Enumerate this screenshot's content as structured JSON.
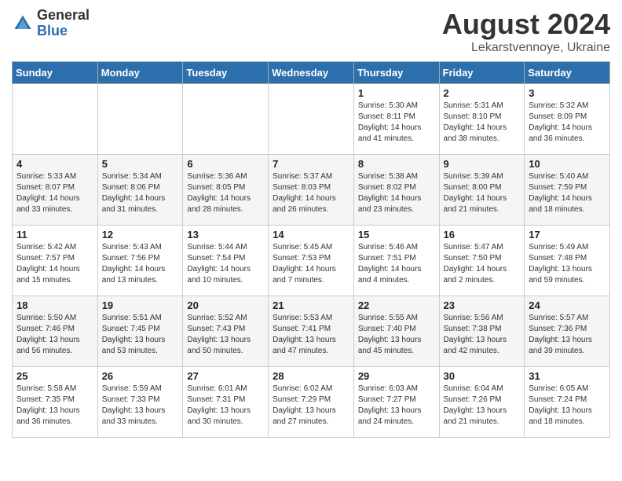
{
  "logo": {
    "general": "General",
    "blue": "Blue"
  },
  "title": "August 2024",
  "location": "Lekarstvennоye, Ukraine",
  "days_of_week": [
    "Sunday",
    "Monday",
    "Tuesday",
    "Wednesday",
    "Thursday",
    "Friday",
    "Saturday"
  ],
  "weeks": [
    [
      {
        "day": "",
        "info": ""
      },
      {
        "day": "",
        "info": ""
      },
      {
        "day": "",
        "info": ""
      },
      {
        "day": "",
        "info": ""
      },
      {
        "day": "1",
        "info": "Sunrise: 5:30 AM\nSunset: 8:11 PM\nDaylight: 14 hours\nand 41 minutes."
      },
      {
        "day": "2",
        "info": "Sunrise: 5:31 AM\nSunset: 8:10 PM\nDaylight: 14 hours\nand 38 minutes."
      },
      {
        "day": "3",
        "info": "Sunrise: 5:32 AM\nSunset: 8:09 PM\nDaylight: 14 hours\nand 36 minutes."
      }
    ],
    [
      {
        "day": "4",
        "info": "Sunrise: 5:33 AM\nSunset: 8:07 PM\nDaylight: 14 hours\nand 33 minutes."
      },
      {
        "day": "5",
        "info": "Sunrise: 5:34 AM\nSunset: 8:06 PM\nDaylight: 14 hours\nand 31 minutes."
      },
      {
        "day": "6",
        "info": "Sunrise: 5:36 AM\nSunset: 8:05 PM\nDaylight: 14 hours\nand 28 minutes."
      },
      {
        "day": "7",
        "info": "Sunrise: 5:37 AM\nSunset: 8:03 PM\nDaylight: 14 hours\nand 26 minutes."
      },
      {
        "day": "8",
        "info": "Sunrise: 5:38 AM\nSunset: 8:02 PM\nDaylight: 14 hours\nand 23 minutes."
      },
      {
        "day": "9",
        "info": "Sunrise: 5:39 AM\nSunset: 8:00 PM\nDaylight: 14 hours\nand 21 minutes."
      },
      {
        "day": "10",
        "info": "Sunrise: 5:40 AM\nSunset: 7:59 PM\nDaylight: 14 hours\nand 18 minutes."
      }
    ],
    [
      {
        "day": "11",
        "info": "Sunrise: 5:42 AM\nSunset: 7:57 PM\nDaylight: 14 hours\nand 15 minutes."
      },
      {
        "day": "12",
        "info": "Sunrise: 5:43 AM\nSunset: 7:56 PM\nDaylight: 14 hours\nand 13 minutes."
      },
      {
        "day": "13",
        "info": "Sunrise: 5:44 AM\nSunset: 7:54 PM\nDaylight: 14 hours\nand 10 minutes."
      },
      {
        "day": "14",
        "info": "Sunrise: 5:45 AM\nSunset: 7:53 PM\nDaylight: 14 hours\nand 7 minutes."
      },
      {
        "day": "15",
        "info": "Sunrise: 5:46 AM\nSunset: 7:51 PM\nDaylight: 14 hours\nand 4 minutes."
      },
      {
        "day": "16",
        "info": "Sunrise: 5:47 AM\nSunset: 7:50 PM\nDaylight: 14 hours\nand 2 minutes."
      },
      {
        "day": "17",
        "info": "Sunrise: 5:49 AM\nSunset: 7:48 PM\nDaylight: 13 hours\nand 59 minutes."
      }
    ],
    [
      {
        "day": "18",
        "info": "Sunrise: 5:50 AM\nSunset: 7:46 PM\nDaylight: 13 hours\nand 56 minutes."
      },
      {
        "day": "19",
        "info": "Sunrise: 5:51 AM\nSunset: 7:45 PM\nDaylight: 13 hours\nand 53 minutes."
      },
      {
        "day": "20",
        "info": "Sunrise: 5:52 AM\nSunset: 7:43 PM\nDaylight: 13 hours\nand 50 minutes."
      },
      {
        "day": "21",
        "info": "Sunrise: 5:53 AM\nSunset: 7:41 PM\nDaylight: 13 hours\nand 47 minutes."
      },
      {
        "day": "22",
        "info": "Sunrise: 5:55 AM\nSunset: 7:40 PM\nDaylight: 13 hours\nand 45 minutes."
      },
      {
        "day": "23",
        "info": "Sunrise: 5:56 AM\nSunset: 7:38 PM\nDaylight: 13 hours\nand 42 minutes."
      },
      {
        "day": "24",
        "info": "Sunrise: 5:57 AM\nSunset: 7:36 PM\nDaylight: 13 hours\nand 39 minutes."
      }
    ],
    [
      {
        "day": "25",
        "info": "Sunrise: 5:58 AM\nSunset: 7:35 PM\nDaylight: 13 hours\nand 36 minutes."
      },
      {
        "day": "26",
        "info": "Sunrise: 5:59 AM\nSunset: 7:33 PM\nDaylight: 13 hours\nand 33 minutes."
      },
      {
        "day": "27",
        "info": "Sunrise: 6:01 AM\nSunset: 7:31 PM\nDaylight: 13 hours\nand 30 minutes."
      },
      {
        "day": "28",
        "info": "Sunrise: 6:02 AM\nSunset: 7:29 PM\nDaylight: 13 hours\nand 27 minutes."
      },
      {
        "day": "29",
        "info": "Sunrise: 6:03 AM\nSunset: 7:27 PM\nDaylight: 13 hours\nand 24 minutes."
      },
      {
        "day": "30",
        "info": "Sunrise: 6:04 AM\nSunset: 7:26 PM\nDaylight: 13 hours\nand 21 minutes."
      },
      {
        "day": "31",
        "info": "Sunrise: 6:05 AM\nSunset: 7:24 PM\nDaylight: 13 hours\nand 18 minutes."
      }
    ]
  ]
}
